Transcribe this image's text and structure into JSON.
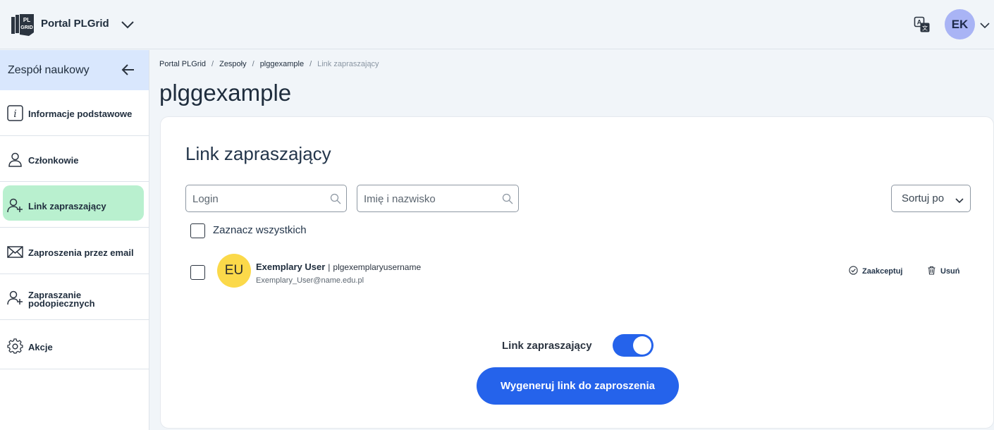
{
  "header": {
    "app_title": "Portal PLGrid",
    "logo_text": "PL GRID",
    "user_initials": "EK",
    "icons": {
      "logo": "plgrid-logo",
      "menu": "chevron-down-icon",
      "translate": "translate-icon",
      "user_menu": "chevron-down-icon"
    }
  },
  "sidebar": {
    "title": "Zespół naukowy",
    "items": [
      {
        "label": "Informacje podstawowe",
        "icon": "info-icon",
        "active": false
      },
      {
        "label": "Członkowie",
        "icon": "person-icon",
        "active": false
      },
      {
        "label": "Link zapraszający",
        "icon": "person-add-icon",
        "active": true
      },
      {
        "label": "Zaproszenia przez email",
        "icon": "envelope-icon",
        "active": false
      },
      {
        "label": "Zapraszanie podopiecznych",
        "label_lines": [
          "Zapraszanie",
          "podopiecznych"
        ],
        "icon": "person-add-icon",
        "active": false
      },
      {
        "label": "Akcje",
        "icon": "gear-icon",
        "active": false
      }
    ]
  },
  "breadcrumbs": [
    "Portal PLGrid",
    "Zespoły",
    "plggexample",
    "Link zapraszający"
  ],
  "page_title": "plggexample",
  "card": {
    "title": "Link zapraszający",
    "search_login_placeholder": "Login",
    "search_name_placeholder": "Imię i nazwisko",
    "sort_label": "Sortuj po",
    "select_all_label": "Zaznacz wszystkich",
    "users": [
      {
        "initials": "EU",
        "name": "Exemplary User",
        "separator": "|",
        "username": "plgexemplaryusername",
        "email": "Exemplary_User@name.edu.pl",
        "accept_label": "Zaakceptuj",
        "remove_label": "Usuń"
      }
    ],
    "toggle_label": "Link zapraszający",
    "toggle_on": true,
    "generate_button": "Wygeneruj link do zaproszenia"
  },
  "colors": {
    "accent": "#2563eb",
    "sidebar_header_bg": "#d9e7fd",
    "active_item_bg": "#b9f0cf",
    "avatar_top_bg": "#a9b4f5",
    "user_avatar_bg": "#fbd94a"
  }
}
